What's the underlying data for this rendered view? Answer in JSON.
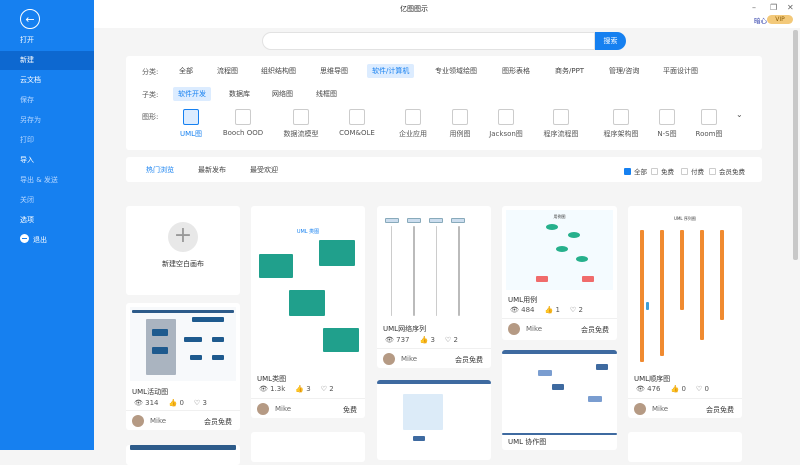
{
  "window": {
    "title": "亿图图示",
    "minimize": "–",
    "restore": "❐",
    "close": "✕",
    "heart_label": "暗心",
    "vip": "VIP"
  },
  "sidebar": {
    "back_icon": "arrow-left-icon",
    "items": [
      {
        "label": "打开"
      },
      {
        "label": "新建"
      },
      {
        "label": "云文档"
      },
      {
        "label": "保存"
      },
      {
        "label": "另存为"
      },
      {
        "label": "打印"
      },
      {
        "label": "导入"
      },
      {
        "label": "导出 & 发送"
      },
      {
        "label": "关闭"
      },
      {
        "label": "选项"
      },
      {
        "label": "退出"
      }
    ]
  },
  "search": {
    "placeholder": "",
    "button": "搜索"
  },
  "filters": {
    "category_label": "分类:",
    "categories": [
      "全部",
      "流程图",
      "组织结构图",
      "思维导图",
      "软件/计算机",
      "专业领域绘图",
      "图形表格",
      "商务/PPT",
      "管理/咨询",
      "平面设计图"
    ],
    "sub_label": "子类:",
    "subcategories": [
      "软件开发",
      "数据库",
      "网络图",
      "线框图"
    ],
    "shape_label": "图形:",
    "shapes": [
      "UML图",
      "Booch OOD",
      "数据流模型",
      "COM&OLE",
      "企业应用",
      "用例图",
      "Jackson图",
      "程序流程图",
      "程序架构图",
      "N-S图",
      "Room图"
    ],
    "more_icon": "⌄"
  },
  "tabs": {
    "items": [
      "热门浏览",
      "最新发布",
      "最受欢迎"
    ],
    "checks": [
      {
        "label": "全部",
        "checked": true
      },
      {
        "label": "免费",
        "checked": false
      },
      {
        "label": "付费",
        "checked": false
      },
      {
        "label": "会员免费",
        "checked": false
      }
    ]
  },
  "blank": {
    "label": "新建空白画布",
    "icon": "+"
  },
  "cards": [
    {
      "title": "UML活动图",
      "views": "314",
      "likes": "0",
      "favs": "3",
      "author": "Mike",
      "price": "会员免费"
    },
    {
      "title": "UML类图",
      "thumb_title": "UML 类图",
      "views": "1.3k",
      "likes": "3",
      "favs": "2",
      "author": "Mike",
      "price": "免费"
    },
    {
      "title": "UML网络序列",
      "views": "737",
      "likes": "3",
      "favs": "2",
      "author": "Mike",
      "price": "会员免费"
    },
    {
      "title": "UML用例",
      "thumb_title": "用例图",
      "views": "484",
      "likes": "1",
      "favs": "2",
      "author": "Mike",
      "price": "会员免费"
    },
    {
      "title": "UML 协作图"
    },
    {
      "title": "UML顺序图",
      "thumb_title": "UML 序列图",
      "views": "476",
      "likes": "0",
      "favs": "0",
      "author": "Mike",
      "price": "会员免费"
    }
  ]
}
